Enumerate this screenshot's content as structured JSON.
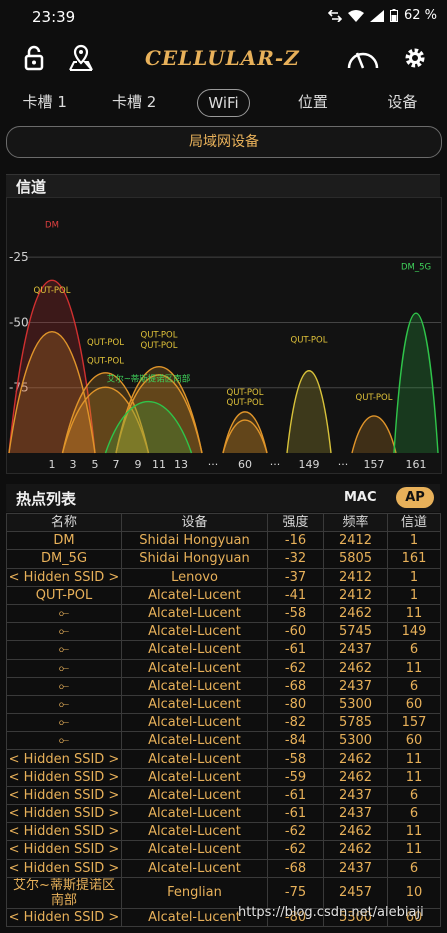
{
  "status": {
    "time": "23:39",
    "battery": "62 %"
  },
  "app": {
    "title": "CELLULAR-Z"
  },
  "tabs": [
    "卡槽 1",
    "卡槽 2",
    "WiFi",
    "位置",
    "设备"
  ],
  "active_tab": "WiFi",
  "lan_button": "局域网设备",
  "channel_section": {
    "title": "信道"
  },
  "hotspot_section": {
    "title": "热点列表",
    "mac_label": "MAC",
    "ap_label": "AP"
  },
  "table": {
    "headers": [
      "名称",
      "设备",
      "强度",
      "频率",
      "信道"
    ],
    "rows": [
      [
        "DM",
        "Shidai Hongyuan",
        "-16",
        "2412",
        "1"
      ],
      [
        "DM_5G",
        "Shidai Hongyuan",
        "-32",
        "5805",
        "161"
      ],
      [
        "< Hidden SSID >",
        "Lenovo",
        "-37",
        "2412",
        "1"
      ],
      [
        "QUT-POL",
        "Alcatel-Lucent",
        "-41",
        "2412",
        "1"
      ],
      [
        "⟜",
        "Alcatel-Lucent",
        "-58",
        "2462",
        "11"
      ],
      [
        "⟜",
        "Alcatel-Lucent",
        "-60",
        "5745",
        "149"
      ],
      [
        "⟜",
        "Alcatel-Lucent",
        "-61",
        "2437",
        "6"
      ],
      [
        "⟜",
        "Alcatel-Lucent",
        "-62",
        "2462",
        "11"
      ],
      [
        "⟜",
        "Alcatel-Lucent",
        "-68",
        "2437",
        "6"
      ],
      [
        "⟜",
        "Alcatel-Lucent",
        "-80",
        "5300",
        "60"
      ],
      [
        "⟜",
        "Alcatel-Lucent",
        "-82",
        "5785",
        "157"
      ],
      [
        "⟜",
        "Alcatel-Lucent",
        "-84",
        "5300",
        "60"
      ],
      [
        "< Hidden SSID >",
        "Alcatel-Lucent",
        "-58",
        "2462",
        "11"
      ],
      [
        "< Hidden SSID >",
        "Alcatel-Lucent",
        "-59",
        "2462",
        "11"
      ],
      [
        "< Hidden SSID >",
        "Alcatel-Lucent",
        "-61",
        "2437",
        "6"
      ],
      [
        "< Hidden SSID >",
        "Alcatel-Lucent",
        "-61",
        "2437",
        "6"
      ],
      [
        "< Hidden SSID >",
        "Alcatel-Lucent",
        "-62",
        "2462",
        "11"
      ],
      [
        "< Hidden SSID >",
        "Alcatel-Lucent",
        "-62",
        "2462",
        "11"
      ],
      [
        "< Hidden SSID >",
        "Alcatel-Lucent",
        "-68",
        "2437",
        "6"
      ],
      [
        "艾尔~蒂斯提诺区南部",
        "Fenglian",
        "-75",
        "2457",
        "10"
      ],
      [
        "< Hidden SSID >",
        "Alcatel-Lucent",
        "-80",
        "5300",
        "60"
      ]
    ]
  },
  "watermark": "https://blog.csdn.net/alebiaji",
  "colors": {
    "accent": "#e8b15a",
    "red": "#d03030",
    "green": "#2fc44a",
    "yellow": "#d8c23a",
    "orange": "#e0952a"
  },
  "chart_data": {
    "type": "area",
    "y_ticks": [
      "-25",
      "-50",
      "-75"
    ],
    "ylim": [
      -100,
      -10
    ],
    "x_ticks": [
      "1",
      "3",
      "5",
      "7",
      "9",
      "11",
      "13",
      "···",
      "60",
      "···",
      "149",
      "···",
      "157",
      "161"
    ],
    "series": [
      {
        "name": "DM",
        "channel": "1",
        "value": -16,
        "color": "#d03030"
      },
      {
        "name": "QUT-POL",
        "channel": "1",
        "value": -41,
        "color": "#e0952a"
      },
      {
        "name": "QUT-POL",
        "channel": "6",
        "value": -61,
        "color": "#e0952a"
      },
      {
        "name": "QUT-POL",
        "channel": "6",
        "value": -68,
        "color": "#e0952a"
      },
      {
        "name": "QUT-POL",
        "channel": "11",
        "value": -58,
        "color": "#e0952a"
      },
      {
        "name": "QUT-POL",
        "channel": "11",
        "value": -62,
        "color": "#e0952a"
      },
      {
        "name": "艾尔~蒂斯提诺区南部",
        "channel": "10",
        "value": -75,
        "color": "#2fc44a"
      },
      {
        "name": "QUT-POL",
        "channel": "60",
        "value": -80,
        "color": "#e0952a"
      },
      {
        "name": "QUT-POL",
        "channel": "60",
        "value": -84,
        "color": "#e0952a"
      },
      {
        "name": "QUT-POL",
        "channel": "149",
        "value": -60,
        "color": "#d8c23a"
      },
      {
        "name": "QUT-POL",
        "channel": "157",
        "value": -82,
        "color": "#e0952a"
      },
      {
        "name": "DM_5G",
        "channel": "161",
        "value": -32,
        "color": "#2fc44a"
      }
    ]
  }
}
